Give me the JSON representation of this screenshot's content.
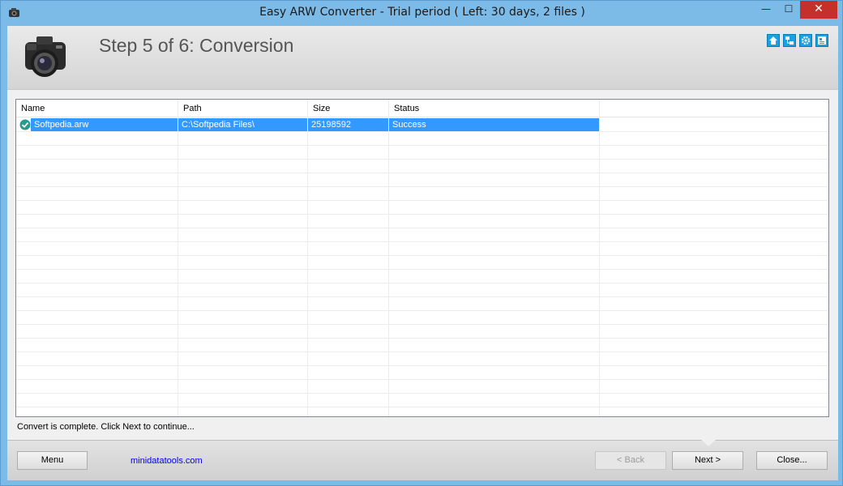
{
  "window": {
    "title": "Easy ARW Converter - Trial period ( Left: 30 days, 2 files )",
    "minimize_glyph": "—",
    "maximize_glyph": "☐",
    "close_glyph": "✕"
  },
  "header": {
    "step_title": "Step 5 of 6: Conversion",
    "icons": [
      "home-icon",
      "network-icon",
      "gear-icon",
      "info-card-icon"
    ]
  },
  "grid": {
    "columns": [
      "Name",
      "Path",
      "Size",
      "Status"
    ],
    "rows": [
      {
        "name": "Softpedia.arw",
        "path": "C:\\Softpedia Files\\",
        "size": "25198592",
        "status": "Success",
        "status_icon": "check-circle-icon"
      }
    ]
  },
  "status_message": "Convert is complete. Click Next to continue...",
  "footer": {
    "menu_label": "Menu",
    "link_text": "minidatatools.com",
    "back_label": "< Back",
    "next_label": "Next >",
    "close_label": "Close..."
  },
  "colors": {
    "selection": "#3399ff",
    "accent_icon": "#1ba1e2",
    "title_bar": "#7cbbe8",
    "close_button": "#c6302b"
  }
}
